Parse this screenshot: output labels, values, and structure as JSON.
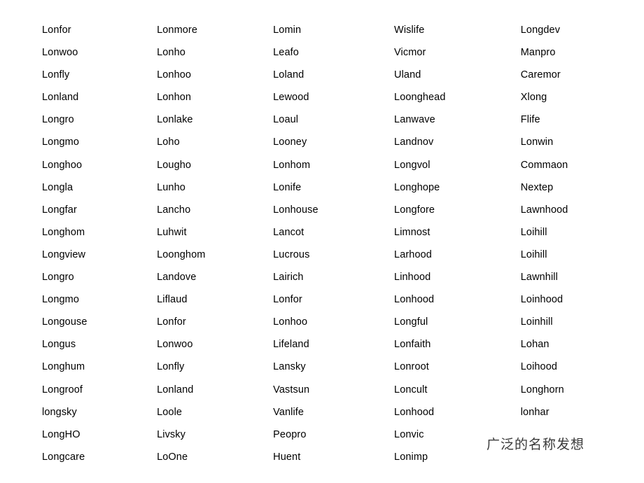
{
  "page": {
    "background_color": "#ffffff",
    "text_color": "#000000",
    "watermark_color": "#3a3a3a"
  },
  "watermark": {
    "text": "广泛的名称发想"
  },
  "name_list": {
    "column_count": 5,
    "row_count": 20,
    "columns": [
      {
        "index": 1,
        "names": [
          "Lonfor",
          "Lonwoo",
          "Lonfly",
          "Lonland",
          "Longro",
          "Longmo",
          "Longhoo",
          "Longla",
          "Longfar",
          "Longhom",
          "Longview",
          "Longro",
          "Longmo",
          "Longouse",
          "Longus",
          "Longhum",
          "Longroof",
          "longsky",
          "LongHO",
          "Longcare"
        ]
      },
      {
        "index": 2,
        "names": [
          "Lonmore",
          "Lonho",
          "Lonhoo",
          "Lonhon",
          "Lonlake",
          "Loho",
          "Lougho",
          "Lunho",
          "Lancho",
          "Luhwit",
          "Loonghom",
          "Landove",
          "Liflaud",
          "Lonfor",
          "Lonwoo",
          "Lonfly",
          "Lonland",
          "Loole",
          "Livsky",
          "LoOne"
        ]
      },
      {
        "index": 3,
        "names": [
          "Lomin",
          "Leafo",
          "Loland",
          "Lewood",
          "Loaul",
          "Looney",
          "Lonhom",
          "Lonife",
          "Lonhouse",
          "Lancot",
          "Lucrous",
          "Lairich",
          "Lonfor",
          "Lonhoo",
          "Lifeland",
          "Lansky",
          "Vastsun",
          "Vanlife",
          "Peopro",
          "Huent"
        ]
      },
      {
        "index": 4,
        "names": [
          "Wislife",
          "Vicmor",
          "Uland",
          "Loonghead",
          "Lanwave",
          "Landnov",
          "Longvol",
          "Longhope",
          "Longfore",
          "Limnost",
          "Larhood",
          "Linhood",
          "Lonhood",
          "Longful",
          "Lonfaith",
          "Lonroot",
          "Loncult",
          "Lonhood",
          "Lonvic",
          "Lonimp"
        ]
      },
      {
        "index": 5,
        "names": [
          "Longdev",
          "Manpro",
          "Caremor",
          "Xlong",
          "Flife",
          "Lonwin",
          "Commaon",
          "Nextep",
          "Lawnhood",
          "Loihill",
          "Loihill",
          "Lawnhill",
          "Loinhood",
          "Loinhill",
          "Lohan",
          "Loihood",
          "Longhorn",
          "lonhar",
          "",
          ""
        ]
      }
    ]
  }
}
